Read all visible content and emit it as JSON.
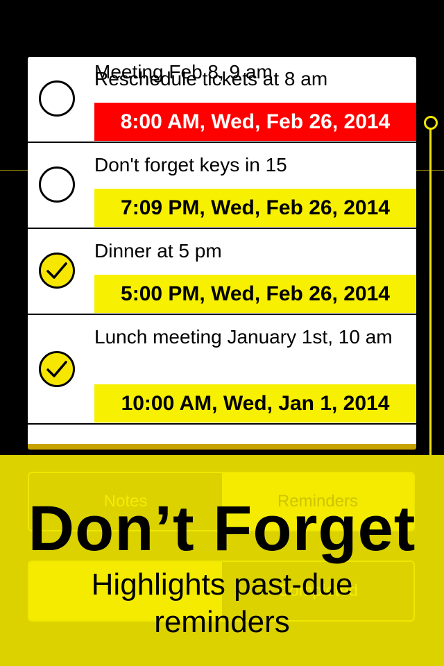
{
  "reminders": [
    {
      "title": "Reschedule tickets at 8 am",
      "date": "8:00 AM, Wed, Feb 26, 2014",
      "completed": false,
      "overdue": true
    },
    {
      "title": "Don't forget keys in 15",
      "date": "7:09 PM, Wed, Feb 26, 2014",
      "completed": false,
      "overdue": false
    },
    {
      "title": "Dinner at 5 pm",
      "date": "5:00 PM, Wed, Feb 26, 2014",
      "completed": true,
      "overdue": false
    },
    {
      "title": "Lunch meeting January 1st, 10 am",
      "date": "10:00 AM, Wed, Jan 1, 2014",
      "completed": true,
      "overdue": false
    }
  ],
  "partial_item": "Meeting Feb 8, 9 am",
  "segment": {
    "notes": "Notes",
    "reminders": "Reminders"
  },
  "segment2": {
    "right": "Completed"
  },
  "promo": {
    "headline": "Don’t Forget",
    "subtitle": "Highlights past-due reminders"
  },
  "colors": {
    "overdue": "#ff0000",
    "accent": "#f7f000",
    "panel": "#dbd200"
  },
  "icons": {
    "unchecked": "empty-circle-icon",
    "checked": "checkmark-circle-icon"
  }
}
